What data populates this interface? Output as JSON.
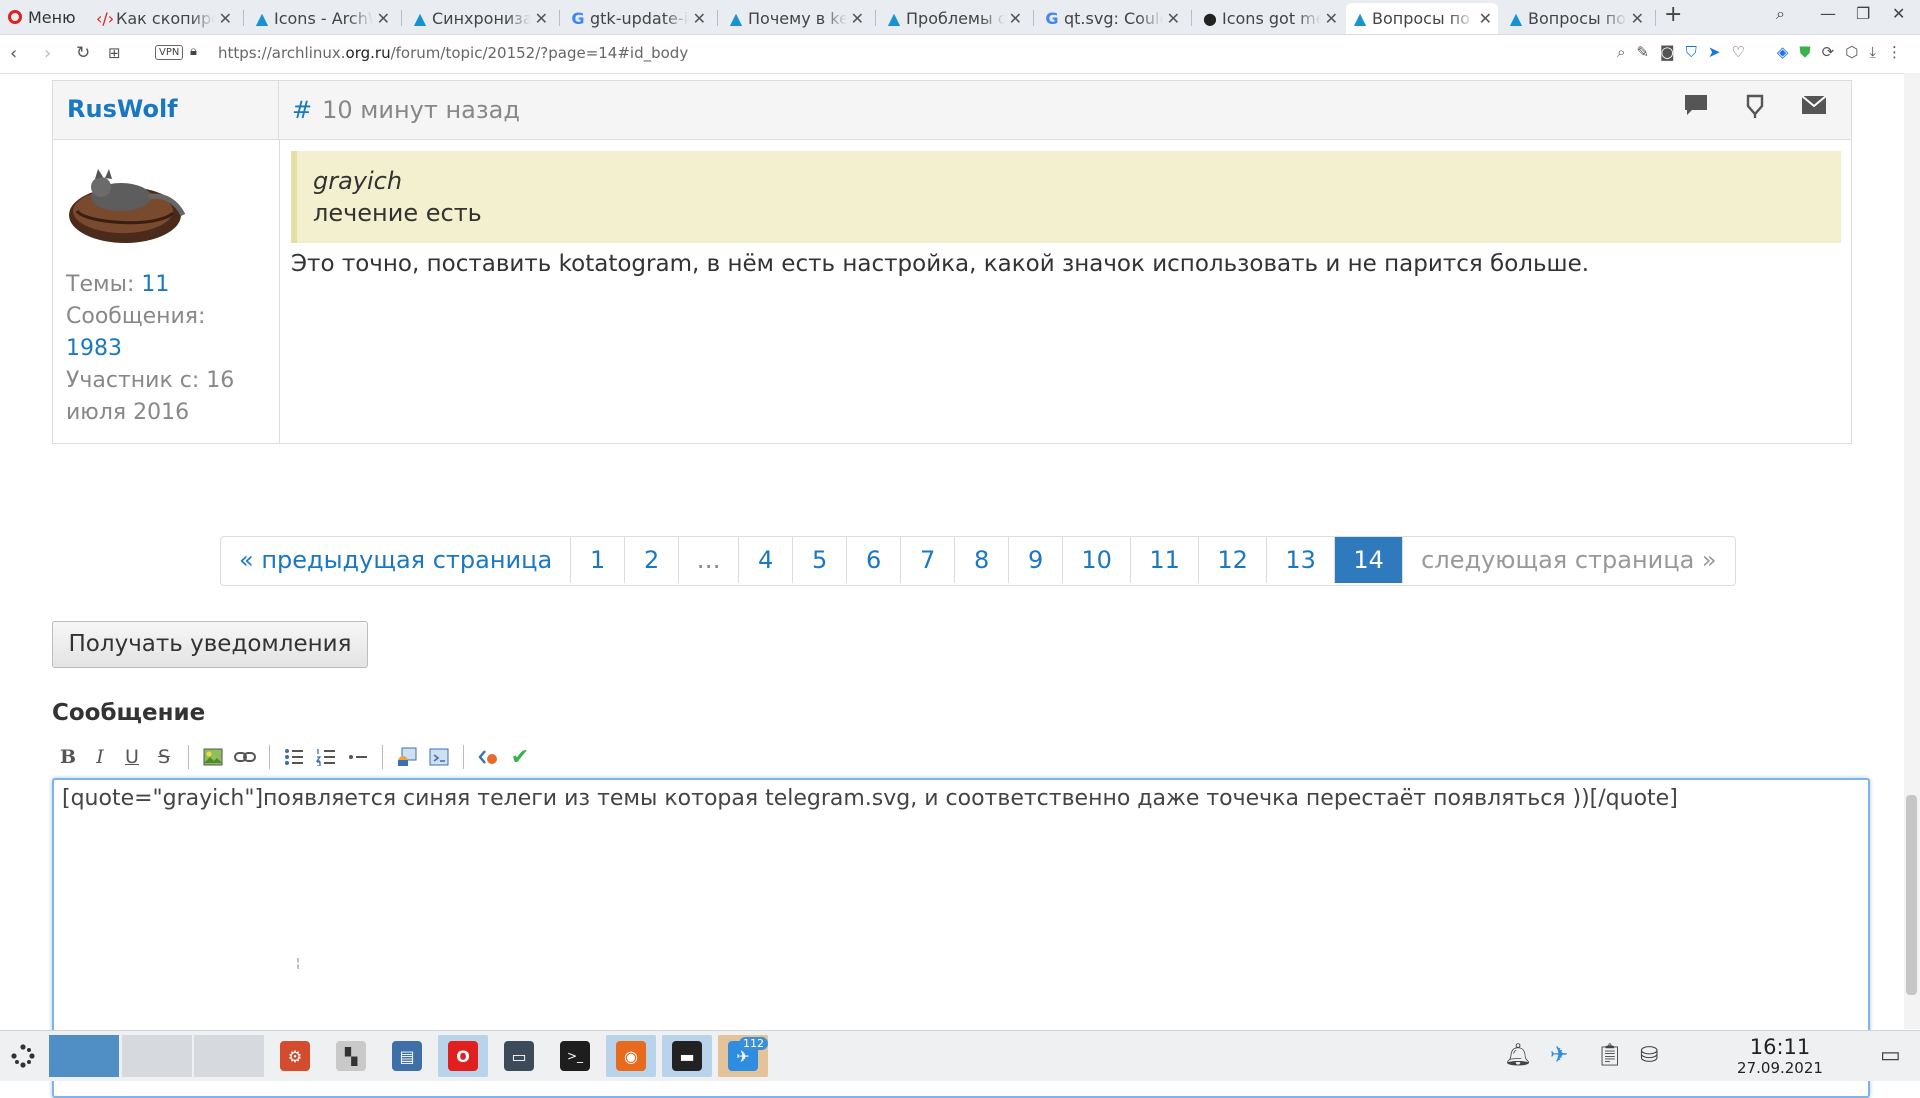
{
  "browser": {
    "menu_label": "Меню",
    "tabs": [
      {
        "title": "Как скопиров",
        "icon": "code-icon"
      },
      {
        "title": "Icons - ArchWiki",
        "icon": "arch-icon"
      },
      {
        "title": "Синхронизация",
        "icon": "arch-icon"
      },
      {
        "title": "gtk-update-icon",
        "icon": "google-icon"
      },
      {
        "title": "Почему в kee",
        "icon": "arch-icon"
      },
      {
        "title": "Проблемы с",
        "icon": "arch-icon"
      },
      {
        "title": "qt.svg: Could",
        "icon": "google-icon"
      },
      {
        "title": "Icons got me",
        "icon": "github-icon"
      },
      {
        "title": "Вопросы по Т",
        "icon": "arch-icon",
        "active": true
      },
      {
        "title": "Вопросы по Т",
        "icon": "arch-icon"
      }
    ],
    "vpn_label": "VPN",
    "url_prefix": "https://archlinux.",
    "url_domain": "org.ru",
    "url_path": "/forum/topic/20152/?page=14#id_body"
  },
  "post": {
    "author": "RusWolf",
    "meta_symbol": "#",
    "time": "10 минут назад",
    "stats": {
      "topics_label": "Темы:",
      "topics_value": "11",
      "messages_label": "Сообщения:",
      "messages_value": "1983",
      "member_since": "Участник с: 16 июля 2016"
    },
    "quote_author": "grayich",
    "quote_text": "лечение есть",
    "text": "Это точно, поставить kotatogram, в нём есть настройка, какой значок использовать и не парится больше."
  },
  "pagination": {
    "prev": "« предыдущая страница",
    "pages": [
      "1",
      "2",
      "…",
      "4",
      "5",
      "6",
      "7",
      "8",
      "9",
      "10",
      "11",
      "12",
      "13",
      "14"
    ],
    "current": "14",
    "next": "следующая страница »"
  },
  "subscribe_label": "Получать уведомления",
  "editor": {
    "label": "Сообщение",
    "tools": [
      "bold",
      "italic",
      "underline",
      "strikethrough",
      "image",
      "link",
      "bulleted-list",
      "numbered-list",
      "horizontal-rule",
      "quote",
      "code",
      "source",
      "preview"
    ],
    "value": "[quote=\"grayich\"]появляется синяя телеги из темы которая telegram.svg, и соответственно даже точечка перестаёт появляться ))[/quote]",
    "cursor_glyph": "¦"
  },
  "taskbar": {
    "badge_count": "112",
    "time": "16:11",
    "date": "27.09.2021"
  },
  "colors": {
    "link": "#1a78c2",
    "page_active": "#2f79bd",
    "quote_bg": "#f3f0cf",
    "editor_focus": "#7fb3ea"
  }
}
